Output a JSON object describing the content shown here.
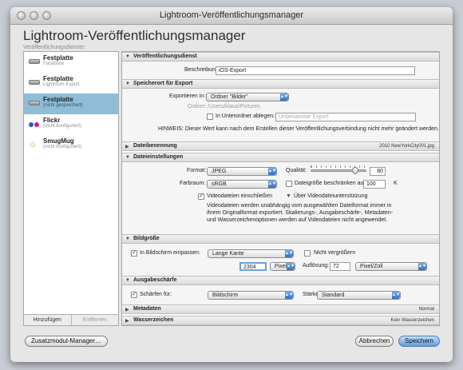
{
  "window": {
    "title": "Lightroom-Veröffentlichungsmanager"
  },
  "header": {
    "title": "Lightroom-Veröffentlichungsmanager",
    "subtitle": "Veröffentlichungsdienste:"
  },
  "sidebar": {
    "items": [
      {
        "name": "Festplatte",
        "sub": "Facebook",
        "icon": "hard-drive-icon"
      },
      {
        "name": "Festplatte",
        "sub": "Lightroom Export",
        "icon": "hard-drive-icon"
      },
      {
        "name": "Festplatte",
        "sub": "(nicht gespeichert)",
        "icon": "hard-drive-icon",
        "selected": true
      },
      {
        "name": "Flickr",
        "sub": "(nicht konfiguriert)",
        "icon": "flickr-icon"
      },
      {
        "name": "SmugMug",
        "sub": "(nicht konfiguriert)",
        "icon": "smugmug-icon"
      }
    ],
    "add_label": "Hinzufügen",
    "remove_label": "Entfernen"
  },
  "sections": {
    "service": {
      "title": "Veröffentlichungsdienst",
      "description_label": "Beschreibung:",
      "description_value": "iOS-Export"
    },
    "location": {
      "title": "Speicherort für Export",
      "export_in_label": "Exportieren in:",
      "export_in_value": "Ordner \"Bilder\"",
      "folder_label": "Ordner:",
      "folder_value": "/Users/klaus/Pictures",
      "subfolder_label": "In Unterordner ablegen:",
      "subfolder_placeholder": "Unbenannter Export",
      "note": "HINWEIS: Dieser Wert kann nach dem Erstellen dieser Veröffentlichungsverbindung nicht mehr geändert werden."
    },
    "naming": {
      "title": "Dateibenennung",
      "summary": "2010 NewYorkCity001.jpg"
    },
    "file": {
      "title": "Dateieinstellungen",
      "format_label": "Format:",
      "format_value": "JPEG",
      "quality_label": "Qualität:",
      "quality_value": "80",
      "quality_fraction": 0.8,
      "colorspace_label": "Farbraum:",
      "colorspace_value": "sRGB",
      "limit_label": "Dateigröße beschränken auf:",
      "limit_value": "100",
      "limit_unit": "K",
      "include_video_label": "Videodateien einschließen",
      "video_support_label": "Über Videodateiunterstützung",
      "video_text_1": "Videodateien werden unabhängig vom ausgewählten Dateiformat immer in",
      "video_text_2": "ihrem Originalformat exportiert. Skalierungs-, Ausgabeschärfe-, Metadaten-",
      "video_text_3": "und Wasserzeichenoptionen werden auf Videodateien nicht angewendet."
    },
    "size": {
      "title": "Bildgröße",
      "fit_label": "In Bildschirm einpassen:",
      "fit_value": "Lange Kante",
      "no_enlarge_label": "Nicht vergrößern",
      "size_value": "2304",
      "size_unit": "Pixel",
      "resolution_label": "Auflösung:",
      "resolution_value": "72",
      "resolution_unit": "Pixel/Zoll"
    },
    "sharpen": {
      "title": "Ausgabeschärfe",
      "sharpen_label": "Schärfen für:",
      "sharpen_value": "Bildschirm",
      "strength_label": "Stärke:",
      "strength_value": "Standard"
    },
    "metadata": {
      "title": "Metadaten",
      "summary": "Normal"
    },
    "watermark": {
      "title": "Wasserzeichen",
      "summary": "Kein Wasserzeichen"
    }
  },
  "footer": {
    "plugin_manager": "Zusatzmodul-Manager…",
    "cancel": "Abbrechen",
    "save": "Speichern"
  },
  "colors": {
    "selection": "#8fbcd7",
    "accent": "#2f6fc9"
  }
}
